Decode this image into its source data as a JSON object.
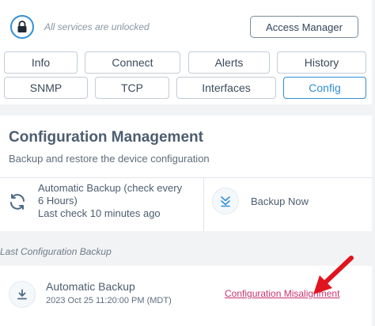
{
  "header": {
    "status_text": "All services are unlocked",
    "access_button": "Access Manager",
    "lock_icon": "lock-icon"
  },
  "tabs": {
    "row1": [
      "Info",
      "Connect",
      "Alerts",
      "History"
    ],
    "row2": [
      "SNMP",
      "TCP",
      "Interfaces",
      "Config"
    ],
    "active": "Config"
  },
  "config": {
    "title": "Configuration Management",
    "subtitle": "Backup and restore the device configuration",
    "auto_line1": "Automatic Backup (check every",
    "auto_line2": "6 Hours)",
    "auto_line3": "Last check 10 minutes ago",
    "backup_now": "Backup Now"
  },
  "last_backup": {
    "section_label": "Last Configuration Backup",
    "name": "Automatic Backup",
    "date": "2023 Oct 25 11:20:00 PM (MDT)",
    "link": "Configuration Misalignment"
  },
  "colors": {
    "accent": "#2f8fd8",
    "link": "#c8336e",
    "annotation_arrow": "#e0141e"
  }
}
